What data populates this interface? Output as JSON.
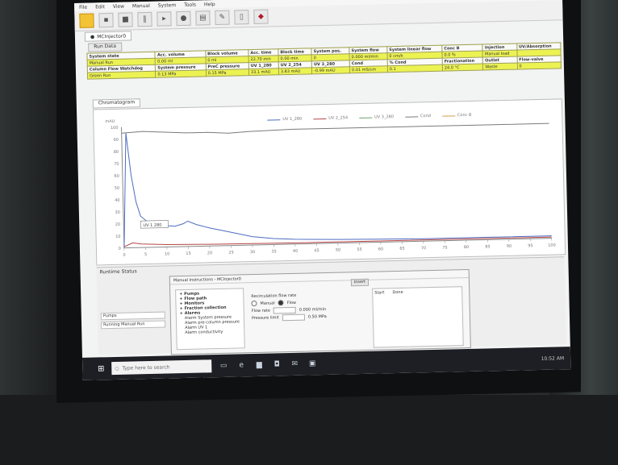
{
  "app": {
    "menu": [
      "File",
      "Edit",
      "View",
      "Manual",
      "System",
      "Tools",
      "Help"
    ],
    "document_tab": "MCInjector0",
    "run_tab": "Run Data"
  },
  "run_grid": {
    "row1_headers": [
      "System state",
      "Acc. volume",
      "Block volume",
      "Acc. time",
      "Block time",
      "System pos.",
      "System flow",
      "System linear flow",
      "Conc B",
      "Injection",
      "UV/Absorption"
    ],
    "row1_values": [
      "Manual Run",
      "0.00 ml",
      "0 ml",
      "22.70 min",
      "0.00 min",
      "0",
      "0.000 ml/min",
      "0 cm/h",
      "0.0 %",
      "Manual load",
      ""
    ],
    "row2_headers": [
      "Column Flow Watchdog",
      "System pressure",
      "PreC pressure",
      "UV 1_280",
      "UV 2_254",
      "UV 3_280",
      "Cond",
      "% Cond",
      "Fractionation",
      "Outlet",
      "Flow-valve"
    ],
    "row2_values": [
      "Green Run",
      "0.13 MPa",
      "0.15 MPa",
      "33.1 mAU",
      "3.83 mAU",
      "-0.99 mAU",
      "0.01 mS/cm",
      "0.1",
      "24.0 °C",
      "Waste",
      "0"
    ]
  },
  "chromatogram": {
    "tab_label": "Chromatogram",
    "legend": [
      "UV 1_280",
      "UV 2_254",
      "UV 3_280",
      "Cond",
      "Conc B"
    ],
    "y_ticks": [
      "100",
      "90",
      "80",
      "70",
      "60",
      "50",
      "40",
      "30",
      "20",
      "10",
      "0"
    ],
    "x_ticks": [
      "0",
      "5",
      "10",
      "15",
      "20",
      "25",
      "30",
      "35",
      "40",
      "45",
      "50",
      "55",
      "60",
      "65",
      "70",
      "75",
      "80",
      "85",
      "90",
      "95",
      "100"
    ],
    "peak_marker": "UV 1 280"
  },
  "chart_data": {
    "type": "line",
    "title": "",
    "xlabel": "",
    "ylabel": "mAU",
    "ylim": [
      0,
      100
    ],
    "xlim": [
      0,
      100
    ],
    "series": [
      {
        "name": "UV 1_280",
        "color": "#4d6cc0",
        "points": [
          [
            0,
            0
          ],
          [
            1,
            95
          ],
          [
            2,
            60
          ],
          [
            3,
            38
          ],
          [
            4,
            26
          ],
          [
            6,
            20
          ],
          [
            9,
            18
          ],
          [
            12,
            17
          ],
          [
            14,
            19
          ],
          [
            15,
            21
          ],
          [
            17,
            18
          ],
          [
            20,
            15
          ],
          [
            25,
            11
          ],
          [
            30,
            7
          ],
          [
            35,
            5
          ],
          [
            40,
            4
          ],
          [
            50,
            3
          ],
          [
            60,
            2.5
          ],
          [
            70,
            2
          ],
          [
            80,
            2
          ],
          [
            90,
            2
          ],
          [
            100,
            2
          ]
        ]
      },
      {
        "name": "Cond",
        "color": "#7a7a7a",
        "points": [
          [
            0,
            95
          ],
          [
            5,
            96
          ],
          [
            10,
            95
          ],
          [
            15,
            94
          ],
          [
            20,
            94
          ],
          [
            25,
            93
          ],
          [
            30,
            94
          ],
          [
            40,
            95
          ],
          [
            50,
            95
          ],
          [
            60,
            95
          ],
          [
            70,
            95
          ],
          [
            80,
            95
          ],
          [
            90,
            95
          ],
          [
            100,
            95
          ]
        ]
      },
      {
        "name": "UV 2_254",
        "color": "#b64545",
        "points": [
          [
            0,
            1
          ],
          [
            2,
            4
          ],
          [
            4,
            3
          ],
          [
            10,
            2
          ],
          [
            20,
            1.5
          ],
          [
            40,
            1
          ],
          [
            60,
            1
          ],
          [
            80,
            1
          ],
          [
            100,
            1
          ]
        ]
      }
    ]
  },
  "bottom_panel": {
    "tab_label": "Runtime Status",
    "dialog_title": "Manual Instructions - MCInjector0",
    "tree_items": [
      "Pumps",
      "Flow path",
      "Monitors",
      "Fraction collection",
      "Alarms",
      "Alarm System pressure",
      "Alarm pre-column pressure",
      "Alarm UV 1",
      "Alarm conductivity"
    ],
    "parameter_label": "Recirculation flow rate",
    "mode_options": [
      "Manual",
      "Flow"
    ],
    "fields": [
      {
        "label": "Flow rate",
        "value": "0.000 ml/min"
      },
      {
        "label": "Pressure limit",
        "value": "0.50 MPa"
      }
    ],
    "right_headers": [
      "Start",
      "Done"
    ],
    "apply_label": "Insert",
    "left_list": [
      "Pumps",
      "Running Manual Run"
    ]
  },
  "taskbar": {
    "search_placeholder": "Type here to search",
    "icons": [
      "task-view-icon",
      "edge-icon",
      "file-explorer-icon",
      "store-icon",
      "mail-icon",
      "app-icon"
    ],
    "tray_time": "10:52 AM"
  }
}
